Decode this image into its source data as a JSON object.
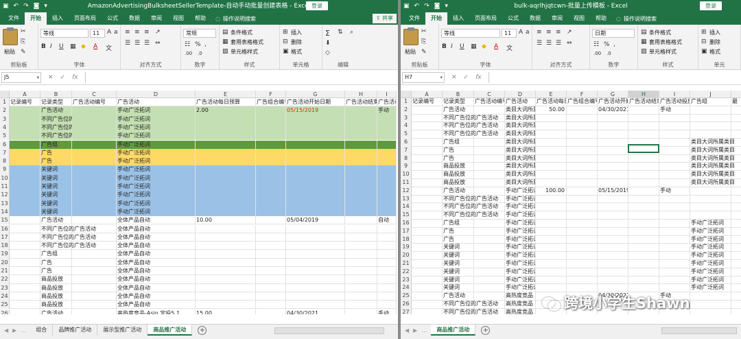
{
  "left": {
    "title": "AmazonAdvertisingBulksheetSellerTemplate-自动手动批量创建表格 - Excel",
    "login": "登录",
    "menu": [
      "文件",
      "开始",
      "插入",
      "页面布局",
      "公式",
      "数据",
      "审阅",
      "视图",
      "帮助"
    ],
    "search_label": "操作说明搜索",
    "share": "共享",
    "ribbon": {
      "paste": "粘贴",
      "clipboard": "剪贴板",
      "font_name": "等线",
      "font_size": "11",
      "font_group": "字体",
      "align_group": "对齐方式",
      "number_format": "常规",
      "number_group": "数字",
      "cond_format": "条件格式",
      "table_format": "套用表格格式",
      "cell_style": "单元格样式",
      "styles_group": "样式",
      "insert": "插入",
      "delete": "删除",
      "format": "格式",
      "cells_group": "单元格",
      "edit_group": "编辑"
    },
    "name_box": "J5",
    "fx": [
      "✕",
      "✓",
      "fx"
    ],
    "col_letters": [
      "A",
      "B",
      "C",
      "D",
      "E",
      "F",
      "G",
      "H",
      "I"
    ],
    "headers": [
      "记录编号",
      "记录类型",
      "广告活动编号",
      "广告活动",
      "广告活动每日预算",
      "广告组合编号",
      "广告活动开始日期",
      "广告活动结束日期",
      "广告活动"
    ],
    "rows": [
      {
        "n": "2",
        "b": "广告活动",
        "d": "手动广泛拓词",
        "e": "2.00",
        "g": "05/15/2019",
        "i": "手动",
        "fill": "#c4dfb3"
      },
      {
        "n": "3",
        "b": "不同广告位的广告活动",
        "d": "手动广泛拓词",
        "fill": "#c4dfb3"
      },
      {
        "n": "4",
        "b": "不同广告位的广告活动",
        "d": "手动广泛拓词",
        "fill": "#c4dfb3"
      },
      {
        "n": "5",
        "b": "不同广告位的广告活动",
        "d": "手动广泛拓词",
        "fill": "#c4dfb3"
      },
      {
        "n": "6",
        "b": "广告组",
        "d": "手动广泛拓词",
        "fill": "#5f9a3e"
      },
      {
        "n": "7",
        "b": "广告",
        "d": "手动广泛拓词",
        "fill": "#ffd966"
      },
      {
        "n": "8",
        "b": "广告",
        "d": "手动广泛拓词",
        "fill": "#ffd966"
      },
      {
        "n": "9",
        "b": "关键词",
        "d": "手动广泛拓词",
        "fill": "#9bc2e6"
      },
      {
        "n": "10",
        "b": "关键词",
        "d": "手动广泛拓词",
        "fill": "#9bc2e6"
      },
      {
        "n": "11",
        "b": "关键词",
        "d": "手动广泛拓词",
        "fill": "#9bc2e6"
      },
      {
        "n": "12",
        "b": "关键词",
        "d": "手动广泛拓词",
        "fill": "#9bc2e6"
      },
      {
        "n": "13",
        "b": "关键词",
        "d": "手动广泛拓词",
        "fill": "#9bc2e6"
      },
      {
        "n": "14",
        "b": "关键词",
        "d": "手动广泛拓词",
        "fill": "#9bc2e6"
      },
      {
        "n": "15",
        "b": "广告活动",
        "d": "全体产品自动",
        "e": "10.00",
        "g": "05/04/2019",
        "i": "自动"
      },
      {
        "n": "16",
        "b": "不同广告位的广告活动",
        "d": "全体产品自动"
      },
      {
        "n": "17",
        "b": "不同广告位的广告活动",
        "d": "全体产品自动"
      },
      {
        "n": "18",
        "b": "不同广告位的广告活动",
        "d": "全体产品自动"
      },
      {
        "n": "19",
        "b": "广告组",
        "d": "全体产品自动"
      },
      {
        "n": "20",
        "b": "广告",
        "d": "全体产品自动"
      },
      {
        "n": "21",
        "b": "广告",
        "d": "全体产品自动"
      },
      {
        "n": "22",
        "b": "商品投放",
        "d": "全体产品自动"
      },
      {
        "n": "23",
        "b": "商品投放",
        "d": "全体产品自动"
      },
      {
        "n": "24",
        "b": "商品投放",
        "d": "全体产品自动"
      },
      {
        "n": "25",
        "b": "商品投放",
        "d": "全体产品自动"
      },
      {
        "n": "26",
        "b": "广告活动",
        "d": "高热度竞品-Asin 定投5.1",
        "e": "15.00",
        "g": "04/30/2021",
        "i": "手动"
      },
      {
        "n": "27",
        "b": "不同广告位的广告活动",
        "d": "高热度竞品-Asin 定投5.1"
      },
      {
        "n": "28",
        "b": "不同广告位的广告活动",
        "d": "高热度竞品-Asin 定投5.1"
      }
    ],
    "sheets": [
      "组合",
      "品牌推广活动",
      "展示型推广活动",
      "商品推广活动"
    ],
    "active_sheet": 3
  },
  "right": {
    "title": "bulk-aqrlhjqtcwn-批量上传模板 - Excel",
    "login": "登录",
    "menu": [
      "文件",
      "开始",
      "插入",
      "页面布局",
      "公式",
      "数据",
      "审阅",
      "视图",
      "帮助"
    ],
    "search_label": "操作说明搜索",
    "ribbon": {
      "paste": "粘贴",
      "clipboard": "剪贴板",
      "font_name": "等线",
      "font_size": "11",
      "font_group": "字体",
      "align_group": "对齐方式",
      "number_format": "日期",
      "number_group": "数字",
      "cond_format": "条件格式",
      "table_format": "套用表格格式",
      "cell_style": "单元格样式",
      "styles_group": "样式",
      "insert": "插入",
      "delete": "删除",
      "format": "格式",
      "cells_group": "单元"
    },
    "name_box": "H7",
    "fx": [
      "✕",
      "✓",
      "fx"
    ],
    "col_letters": [
      "A",
      "B",
      "C",
      "D",
      "E",
      "F",
      "G",
      "H",
      "I",
      "J"
    ],
    "headers": [
      "记录编号",
      "记录类型",
      "广告活动编号",
      "广告活动",
      "广告活动每日预算",
      "广告组合编号",
      "广告活动开始日期",
      "广告活动结束日期",
      "广告活动投放类型",
      "广告组",
      "最"
    ],
    "rows": [
      {
        "n": "2",
        "b": "广告活动",
        "d": "类目大词所属",
        "e": "50.00",
        "g": "04/30/2021",
        "i": "手动"
      },
      {
        "n": "3",
        "b": "不同广告位的广告活动",
        "d": "类目大词所属"
      },
      {
        "n": "4",
        "b": "不同广告位的广告活动",
        "d": "类目大词所属"
      },
      {
        "n": "5",
        "b": "不同广告位的广告活动",
        "d": "类目大词所属"
      },
      {
        "n": "6",
        "b": "广告组",
        "d": "类目大词所属",
        "j": "类目大词所属类目"
      },
      {
        "n": "7",
        "b": "广告",
        "d": "类目大词所属",
        "j": "类目大词所属类目"
      },
      {
        "n": "8",
        "b": "广告",
        "d": "类目大词所属",
        "j": "类目大词所属类目"
      },
      {
        "n": "9",
        "b": "商品投放",
        "d": "类目大词所属",
        "j": "类目大词所属类目"
      },
      {
        "n": "10",
        "b": "商品投放",
        "d": "类目大词所属",
        "j": "类目大词所属类目"
      },
      {
        "n": "11",
        "b": "商品投放",
        "d": "类目大词所属",
        "j": "类目大词所属类目"
      },
      {
        "n": "12",
        "b": "广告活动",
        "d": "手动广泛拓词",
        "e": "100.00",
        "g": "05/15/2019",
        "i": "手动"
      },
      {
        "n": "13",
        "b": "不同广告位的广告活动",
        "d": "手动广泛拓词"
      },
      {
        "n": "14",
        "b": "不同广告位的广告活动",
        "d": "手动广泛拓词"
      },
      {
        "n": "15",
        "b": "不同广告位的广告活动",
        "d": "手动广泛拓词"
      },
      {
        "n": "16",
        "b": "广告组",
        "d": "手动广泛拓词",
        "j": "手动广泛拓词"
      },
      {
        "n": "17",
        "b": "广告",
        "d": "手动广泛拓词",
        "j": "手动广泛拓词"
      },
      {
        "n": "18",
        "b": "广告",
        "d": "手动广泛拓词",
        "j": "手动广泛拓词"
      },
      {
        "n": "19",
        "b": "关键词",
        "d": "手动广泛拓词",
        "j": "手动广泛拓词"
      },
      {
        "n": "20",
        "b": "关键词",
        "d": "手动广泛拓词",
        "j": "手动广泛拓词"
      },
      {
        "n": "21",
        "b": "关键词",
        "d": "手动广泛拓词",
        "j": "手动广泛拓词"
      },
      {
        "n": "22",
        "b": "关键词",
        "d": "手动广泛拓词",
        "j": "手动广泛拓词"
      },
      {
        "n": "23",
        "b": "关键词",
        "d": "手动广泛拓词",
        "j": "手动广泛拓词"
      },
      {
        "n": "24",
        "b": "关键词",
        "d": "手动广泛拓词",
        "j": "手动广泛拓词"
      },
      {
        "n": "25",
        "b": "广告活动",
        "d": "高热度竞品",
        "g": "04/30/2021",
        "i": "手动"
      },
      {
        "n": "26",
        "b": "不同广告位的广告活动",
        "d": "高热度竞品"
      },
      {
        "n": "27",
        "b": "不同广告位的广告活动",
        "d": "高热度竞品"
      },
      {
        "n": "28",
        "b": "不同广告位的广告活动",
        "d": "高热度竞品"
      }
    ],
    "sheets": [
      "商品推广活动"
    ],
    "active_sheet": 0
  },
  "watermark": "跨境小学生Shawn",
  "accent": "#217346"
}
